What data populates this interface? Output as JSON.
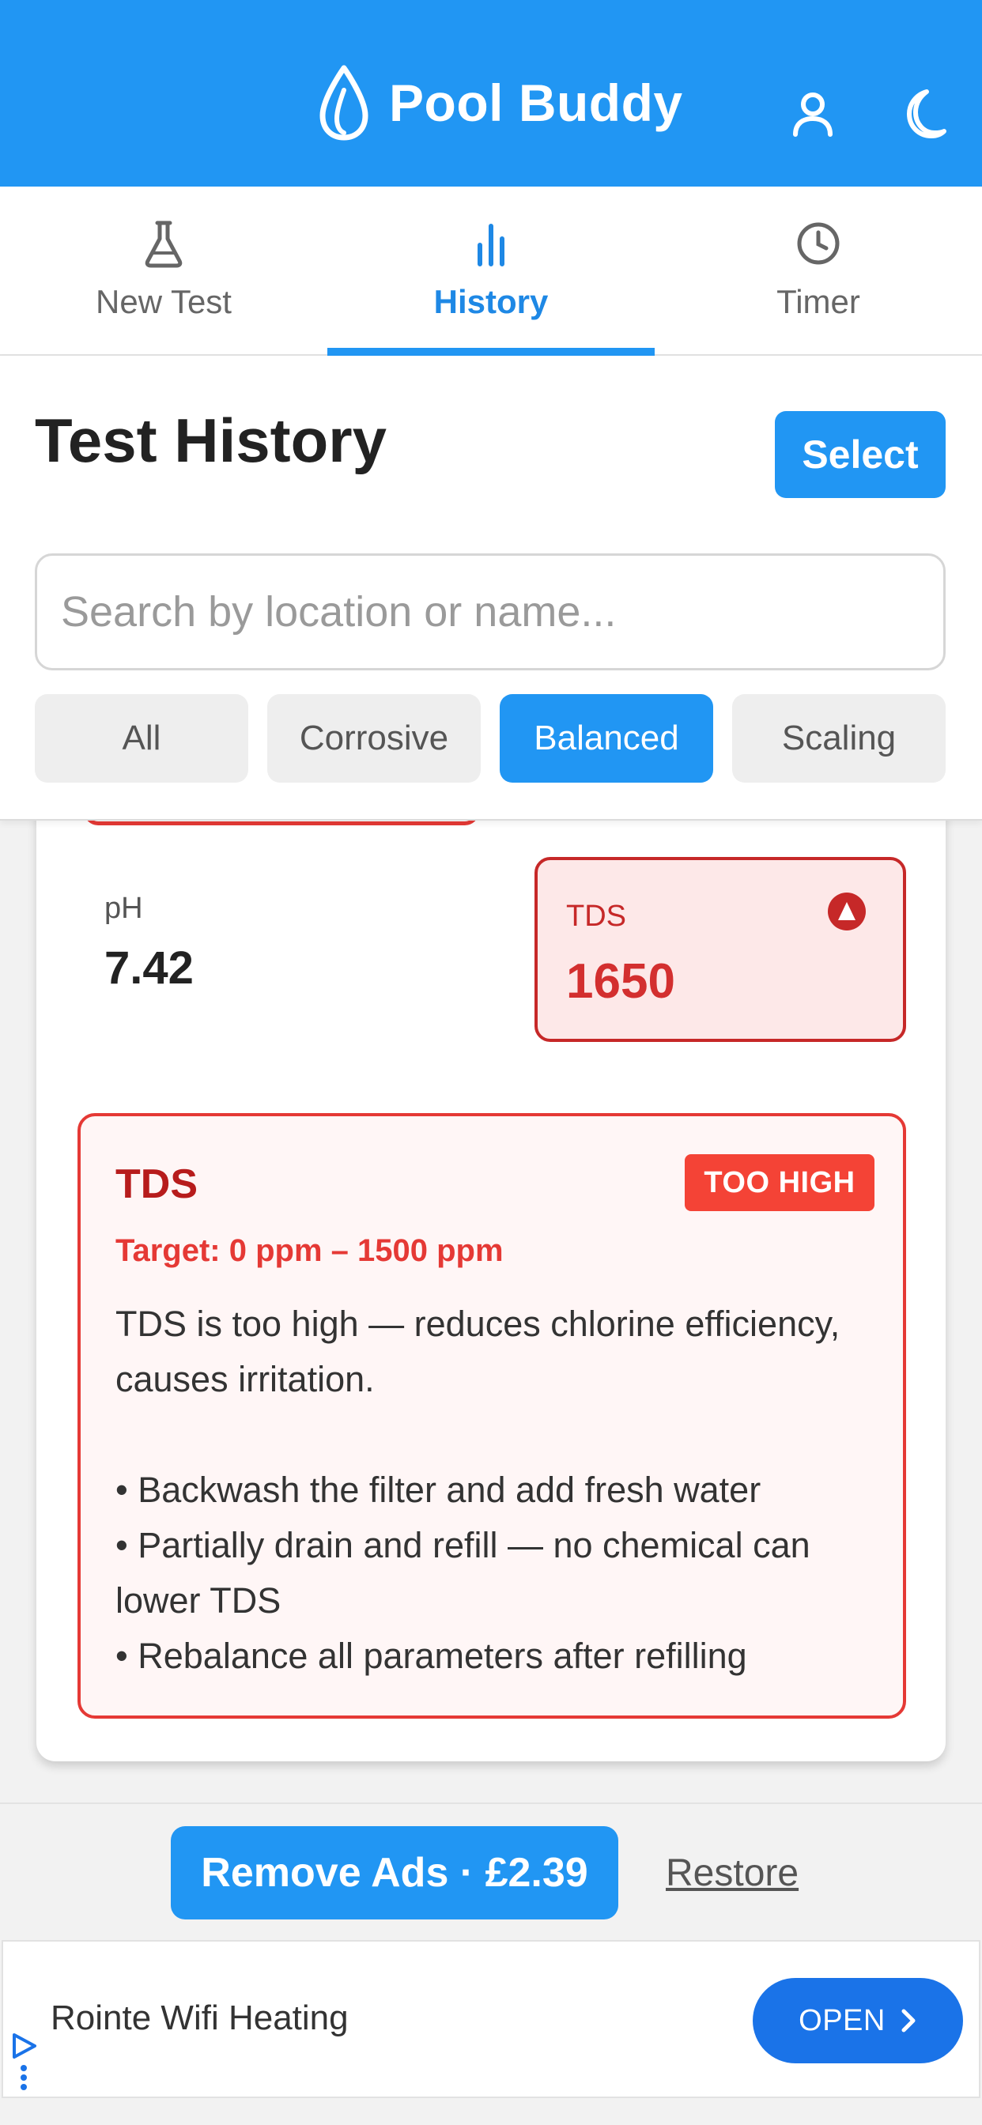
{
  "header": {
    "title": "Pool Buddy",
    "logo_icon": "water-drop-icon",
    "icons": [
      "user-icon",
      "moon-icon"
    ],
    "color": "#2196f3"
  },
  "tabs": [
    {
      "label": "New Test",
      "icon": "flask-icon",
      "active": false
    },
    {
      "label": "History",
      "icon": "bar-chart-icon",
      "active": true
    },
    {
      "label": "Timer",
      "icon": "clock-icon",
      "active": false
    }
  ],
  "history": {
    "title": "Test History",
    "select_label": "Select",
    "search_placeholder": "Search by location or name...",
    "search_value": "",
    "filters": [
      {
        "label": "All",
        "active": false
      },
      {
        "label": "Corrosive",
        "active": false
      },
      {
        "label": "Balanced",
        "active": true
      },
      {
        "label": "Scaling",
        "active": false
      }
    ]
  },
  "reading": {
    "ph_label": "pH",
    "ph_value": "7.42",
    "tds_label": "TDS",
    "tds_value": "1650",
    "tds_alert_icon": "alert-up-icon"
  },
  "detail": {
    "title": "TDS",
    "badge": "TOO HIGH",
    "target": "Target: 0 ppm – 1500 ppm",
    "description": "TDS is too high — reduces chlorine efficiency, causes irritation.",
    "tips": [
      "• Backwash the filter and add fresh water",
      "• Partially drain and refill — no chemical can lower TDS",
      "• Rebalance all parameters after refilling"
    ],
    "alert_color": "#e53935"
  },
  "footer": {
    "remove_ads": "Remove Ads · £2.39",
    "restore": "Restore"
  },
  "ad": {
    "title": "Rointe Wifi Heating",
    "open_label": "OPEN",
    "choices_icon": "ad-choices-icon"
  }
}
